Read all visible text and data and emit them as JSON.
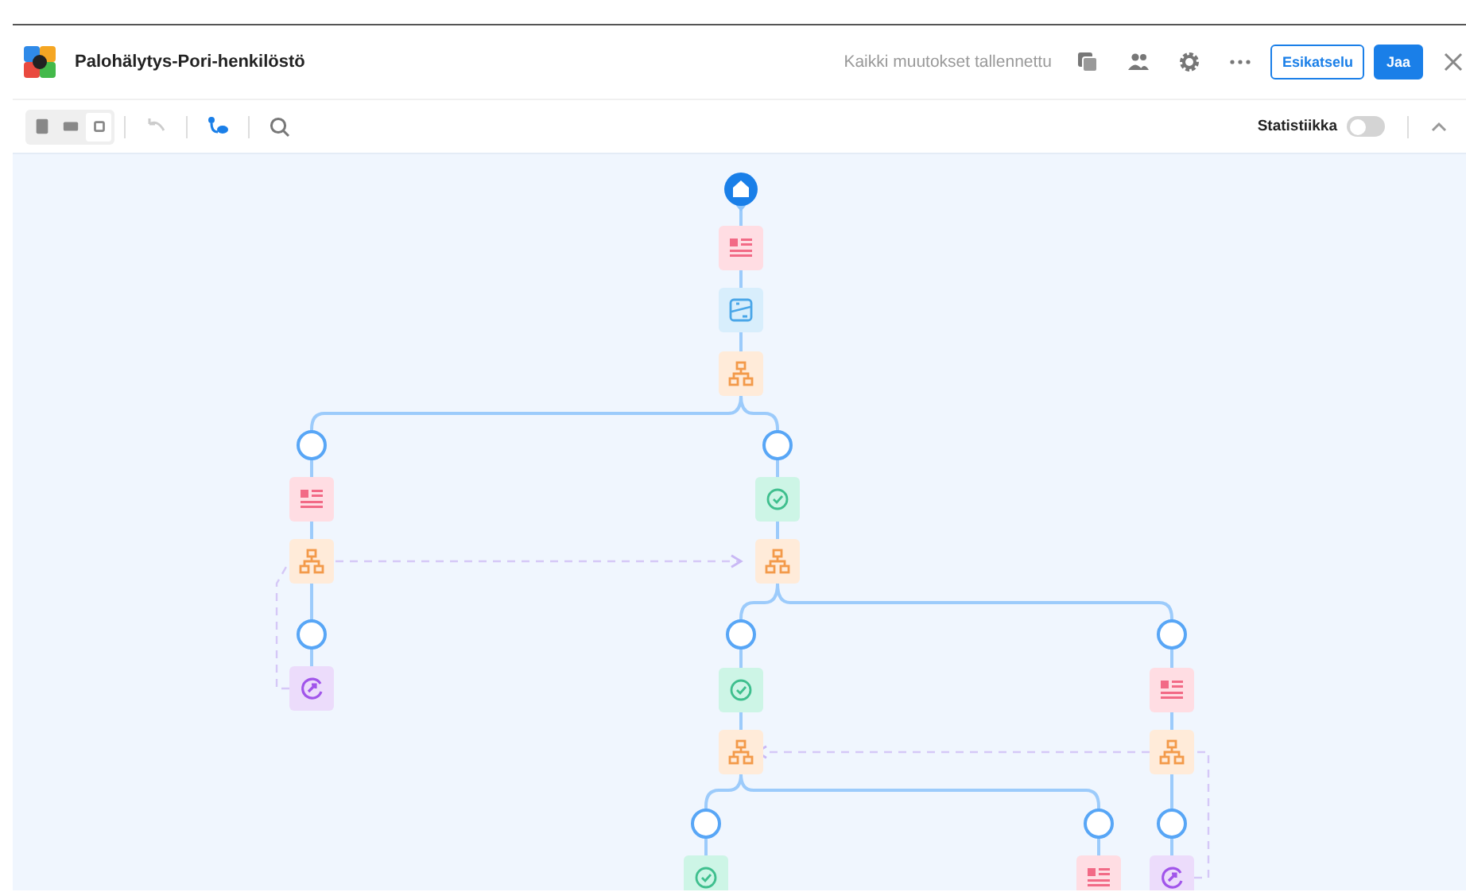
{
  "window": {
    "title": "Palohälytys-Pori-henkilöstö"
  },
  "header": {
    "save_status": "Kaikki muutokset tallennettu",
    "buttons": [
      {
        "label": "Esikatselu",
        "kind": "outline"
      },
      {
        "label": "Jaa",
        "kind": "primary"
      }
    ]
  },
  "toolbar": {
    "view_modes": [
      {
        "kind": "large",
        "selected": false
      },
      {
        "kind": "medium",
        "selected": false
      },
      {
        "kind": "small",
        "selected": true
      }
    ],
    "undo": {
      "disabled": true
    },
    "statistics": {
      "label": "Statistiikka",
      "on": false
    }
  },
  "flow": {
    "nodes": [
      {
        "kind": "start"
      },
      {
        "kind": "form"
      },
      {
        "kind": "image"
      },
      {
        "kind": "branch"
      },
      {
        "kind": "slot"
      },
      {
        "kind": "slot"
      },
      {
        "kind": "form"
      },
      {
        "kind": "branch"
      },
      {
        "kind": "slot"
      },
      {
        "kind": "jump"
      },
      {
        "kind": "check"
      },
      {
        "kind": "branch"
      },
      {
        "kind": "slot"
      },
      {
        "kind": "slot"
      },
      {
        "kind": "check"
      },
      {
        "kind": "form"
      },
      {
        "kind": "branch"
      },
      {
        "kind": "branch"
      },
      {
        "kind": "slot"
      },
      {
        "kind": "slot"
      },
      {
        "kind": "check"
      },
      {
        "kind": "form"
      },
      {
        "kind": "slot"
      },
      {
        "kind": "jump"
      }
    ]
  }
}
